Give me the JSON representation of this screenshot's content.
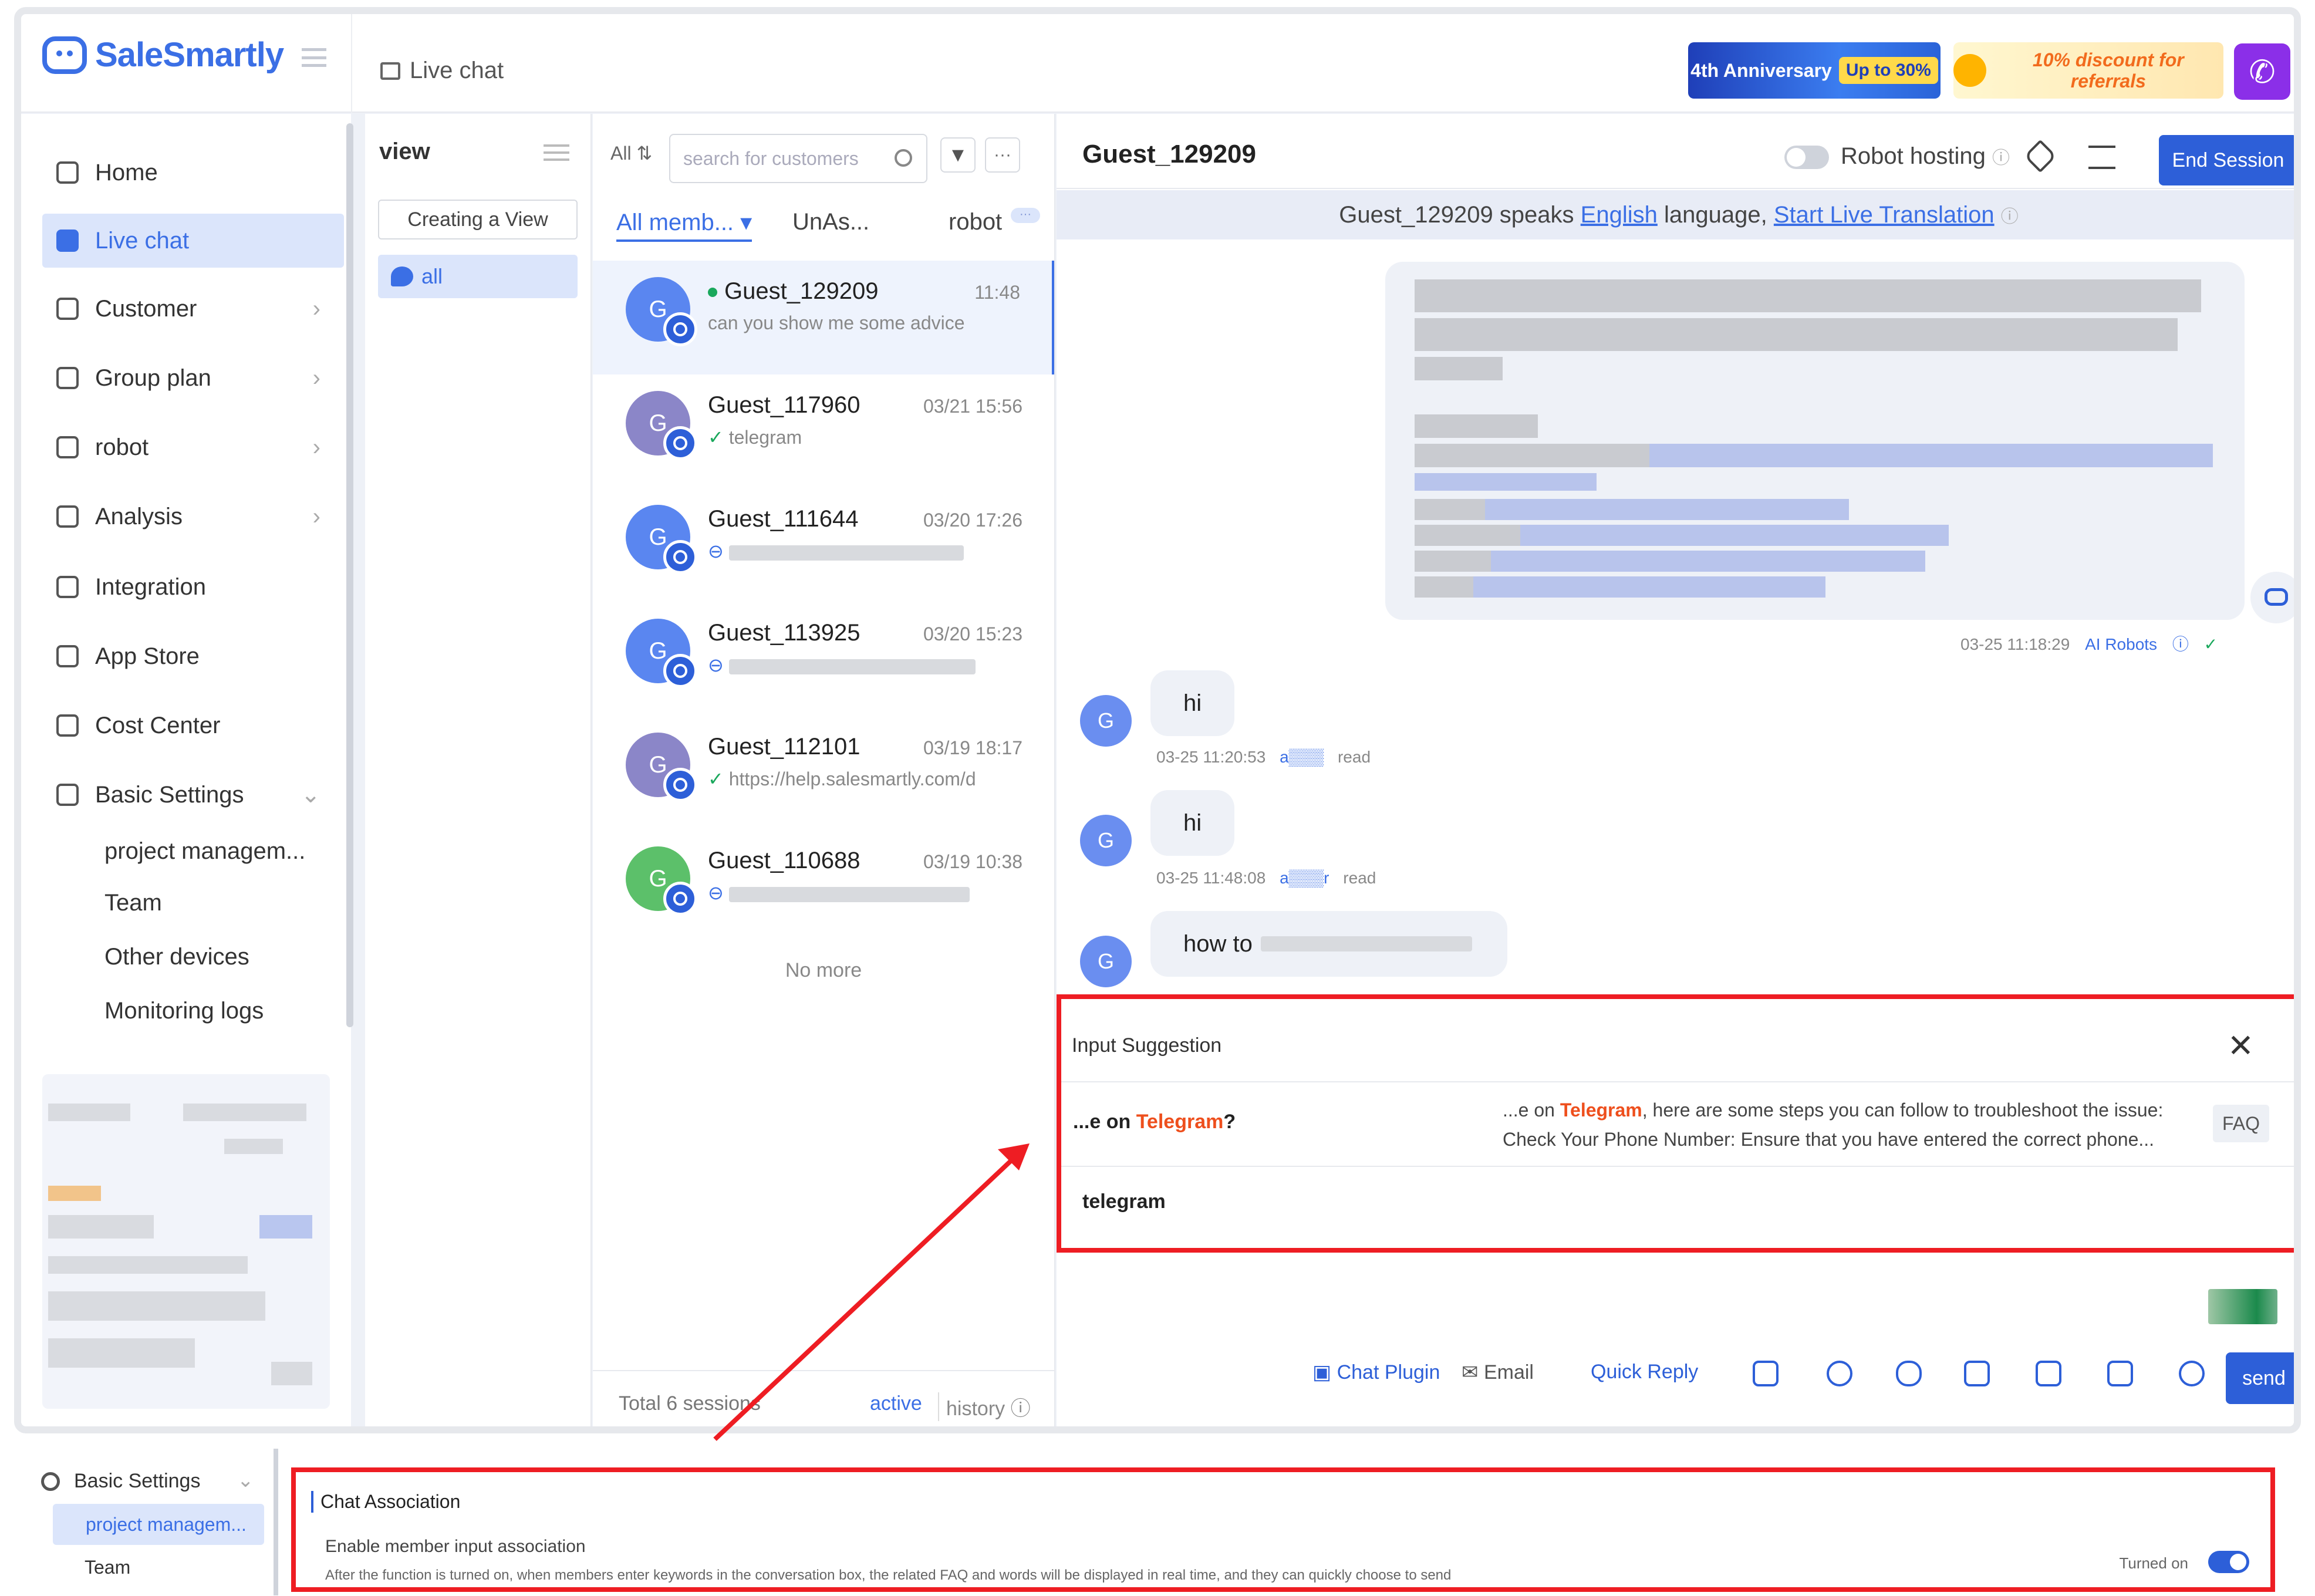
{
  "topbar": {
    "brand": "SaleSmartly",
    "page_tab": "Live chat",
    "banner_anniversary": "4th Anniversary",
    "banner_anniversary_badge": "Up to 30%",
    "banner_discount": "10% discount for referrals"
  },
  "nav": {
    "items": [
      {
        "label": "Home",
        "icon": "home-icon"
      },
      {
        "label": "Live chat",
        "icon": "live-chat-icon",
        "active": true
      },
      {
        "label": "Customer",
        "icon": "customer-icon"
      },
      {
        "label": "Group plan",
        "icon": "send-icon"
      },
      {
        "label": "robot",
        "icon": "robot-icon"
      },
      {
        "label": "Analysis",
        "icon": "analysis-icon"
      },
      {
        "label": "Integration",
        "icon": "integration-icon"
      },
      {
        "label": "App Store",
        "icon": "app-store-icon"
      },
      {
        "label": "Cost Center",
        "icon": "wallet-icon"
      },
      {
        "label": "Basic Settings",
        "icon": "gear-icon"
      }
    ],
    "sub_items": [
      "project managem...",
      "Team",
      "Other devices",
      "Monitoring logs"
    ]
  },
  "view_panel": {
    "title": "view",
    "create_button": "Creating a View",
    "all_label": "all"
  },
  "session_list": {
    "filter_label": "All",
    "search_placeholder": "search for customers",
    "tabs": [
      "All memb...",
      "UnAs...",
      "robot"
    ],
    "sessions": [
      {
        "name": "Guest_129209",
        "time": "11:48",
        "preview": "can you show me some advice",
        "avatar_color": "#5a86f0",
        "online": true
      },
      {
        "name": "Guest_117960",
        "time": "03/21 15:56",
        "preview": "telegram",
        "avatar_color": "#8b86c8",
        "check": true
      },
      {
        "name": "Guest_111644",
        "time": "03/20 17:26",
        "preview": "",
        "avatar_color": "#5a86f0"
      },
      {
        "name": "Guest_113925",
        "time": "03/20 15:23",
        "preview": "",
        "avatar_color": "#5a86f0"
      },
      {
        "name": "Guest_112101",
        "time": "03/19 18:17",
        "preview": "https://help.salesmartly.com/d",
        "avatar_color": "#8b86c8",
        "check": true
      },
      {
        "name": "Guest_110688",
        "time": "03/19 10:38",
        "preview": "",
        "avatar_color": "#5cc06a"
      }
    ],
    "no_more": "No more",
    "total": "Total 6 sessions",
    "footer_active": "active",
    "footer_history": "history"
  },
  "chat": {
    "title": "Guest_129209",
    "robot_hosting": "Robot hosting",
    "end_session": "End Session",
    "translate_prefix": "Guest_129209 speaks",
    "translate_lang": "English",
    "translate_mid": "language,",
    "translate_link": "Start Live Translation",
    "robot_meta_time": "03-25 11:18:29",
    "robot_meta_label": "AI Robots",
    "messages": [
      {
        "avatar": "G",
        "text": "hi",
        "time": "03-25 11:20:53",
        "read": "read"
      },
      {
        "avatar": "G",
        "text": "hi",
        "time": "03-25 11:48:08",
        "read": "read"
      },
      {
        "avatar": "G",
        "text": "how to",
        "time": "",
        "read": ""
      }
    ]
  },
  "suggestion": {
    "header": "Input Suggestion",
    "question_prefix": "...e on",
    "question_keyword": "Telegram",
    "question_suffix": "?",
    "answer_prefix": "...e on",
    "answer_keyword": "Telegram",
    "answer_rest": ", here are some steps you can follow to troubleshoot the issue:",
    "answer_line2": "Check Your Phone Number: Ensure that you have entered the correct phone...",
    "tag": "FAQ",
    "input_value": "telegram"
  },
  "toolbar": {
    "chat_plugin": "Chat Plugin",
    "email": "Email",
    "quick_reply": "Quick Reply",
    "send": "send"
  },
  "settings_strip": {
    "section": "Basic Settings",
    "selected": "project managem...",
    "team": "Team",
    "title": "Chat Association",
    "subtitle": "Enable member input association",
    "description": "After the function is turned on, when members enter keywords in the conversation box, the related FAQ and words will be displayed in real time, and they can quickly choose to send",
    "status": "Turned on"
  },
  "colors": {
    "accent": "#2d5fd8",
    "highlight_red": "#ee1d23",
    "keyword_orange": "#ee4f1d"
  }
}
